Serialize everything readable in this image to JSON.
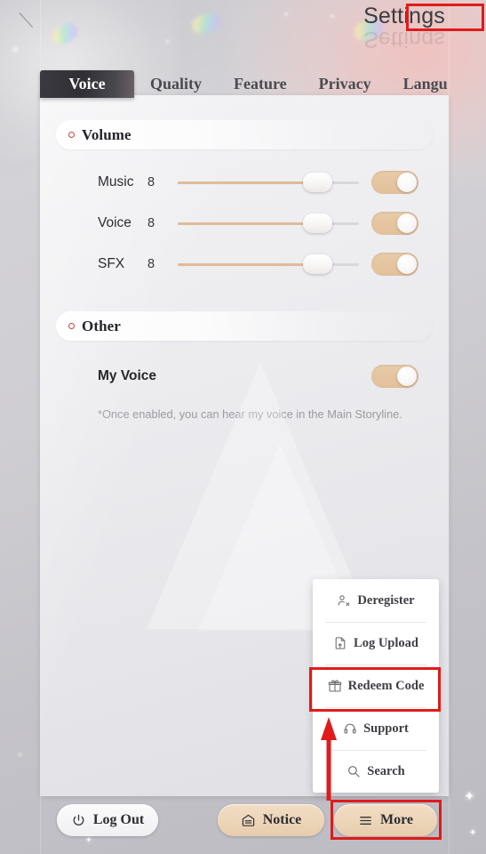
{
  "app": {
    "title": "Settings",
    "title_reflection": "Settings"
  },
  "tabs": [
    {
      "label": "Voice",
      "active": true
    },
    {
      "label": "Quality",
      "active": false
    },
    {
      "label": "Feature",
      "active": false
    },
    {
      "label": "Privacy",
      "active": false
    },
    {
      "label": "Langu",
      "active": false
    }
  ],
  "sections": {
    "volume": {
      "title": "Volume",
      "subtitle": "",
      "rows": [
        {
          "label": "Music",
          "value": "8",
          "fill_percent": 77,
          "toggle_on": true
        },
        {
          "label": "Voice",
          "value": "8",
          "fill_percent": 77,
          "toggle_on": true
        },
        {
          "label": "SFX",
          "value": "8",
          "fill_percent": 77,
          "toggle_on": true
        }
      ]
    },
    "other": {
      "title": "Other",
      "subtitle": "",
      "my_voice": {
        "label": "My Voice",
        "toggle_on": true,
        "note": "*Once enabled, you can hear my voice in the Main Storyline."
      }
    }
  },
  "more_menu": {
    "items": [
      {
        "label": "Deregister",
        "icon": "user-remove-icon"
      },
      {
        "label": "Log Upload",
        "icon": "file-upload-icon"
      },
      {
        "label": "Redeem Code",
        "icon": "gift-icon"
      },
      {
        "label": "Support",
        "icon": "headset-icon"
      },
      {
        "label": "Search",
        "icon": "search-icon"
      }
    ]
  },
  "bottom_bar": {
    "log_out": {
      "label": "Log Out",
      "icon": "power-icon"
    },
    "notice": {
      "label": "Notice",
      "icon": "mail-icon"
    },
    "more": {
      "label": "More",
      "icon": "hamburger-icon"
    }
  },
  "colors": {
    "accent_tan": "#e2c09a",
    "annotation_red": "#e01b1b",
    "section_dot": "#c3433f",
    "tab_active_bg": "#2f2f35",
    "slider_fill": "#e0bb99"
  }
}
